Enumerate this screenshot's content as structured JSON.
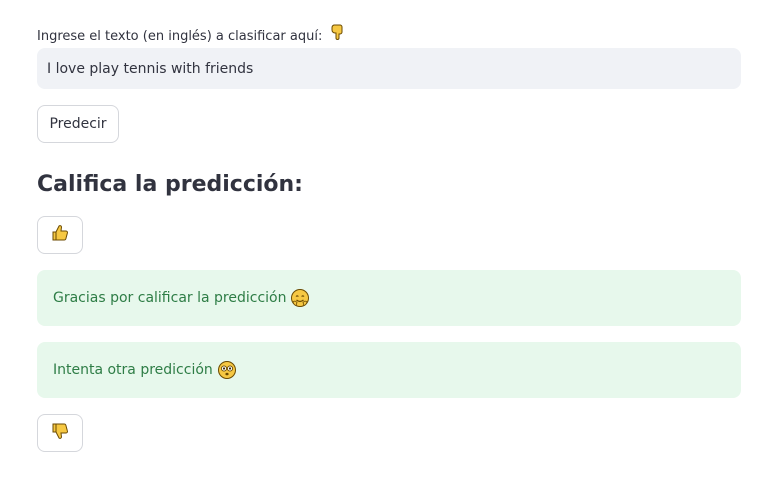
{
  "input": {
    "label": "Ingrese el texto (en inglés) a clasificar aquí:",
    "label_icon": "pointing-down-icon",
    "value": "I love play tennis with friends"
  },
  "predict_button": {
    "label": "Predecir"
  },
  "rating": {
    "heading": "Califica la predicción:",
    "thumbs_up_icon": "thumbs-up-icon",
    "thumbs_down_icon": "thumbs-down-icon"
  },
  "alerts": [
    {
      "text": "Gracias por calificar la predicción",
      "icon": "smiling-hugging-face-icon"
    },
    {
      "text": "Intenta otra predicción",
      "icon": "flushed-face-icon"
    }
  ],
  "colors": {
    "success_bg": "#e7f8ec",
    "success_text": "#2e7d46",
    "input_bg": "#f0f2f6",
    "emoji_yellow": "#f6c843"
  }
}
